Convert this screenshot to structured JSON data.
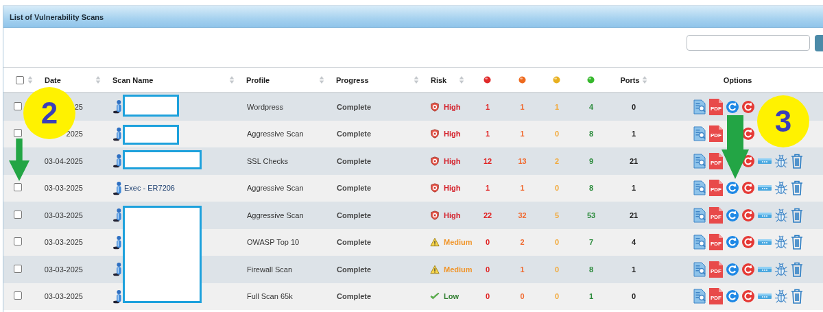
{
  "panel": {
    "title": "List of Vulnerability Scans"
  },
  "table": {
    "select_all": {
      "checked": false
    },
    "columns": [
      {
        "kind": "text",
        "label": "Date",
        "sortable": true
      },
      {
        "kind": "text",
        "label": "Scan Name",
        "sortable": true
      },
      {
        "kind": "text",
        "label": "Profile",
        "sortable": true
      },
      {
        "kind": "text",
        "label": "Progress",
        "sortable": true
      },
      {
        "kind": "text",
        "label": "Risk",
        "sortable": true
      },
      {
        "kind": "dot",
        "color": "#e02a2a"
      },
      {
        "kind": "dot",
        "color": "#ee6a1e"
      },
      {
        "kind": "dot",
        "color": "#e8b020"
      },
      {
        "kind": "dot",
        "color": "#36b82c"
      },
      {
        "kind": "text",
        "label": "Ports",
        "sortable": true
      },
      {
        "kind": "text",
        "label": "Options",
        "sortable": false
      }
    ],
    "rows": [
      {
        "checked": false,
        "date": "25",
        "profile": "Wordpress",
        "progress": "Complete",
        "risk": {
          "label": "High",
          "kind": "high"
        },
        "counts": [
          "1",
          "1",
          "1",
          "4"
        ],
        "ports": "0",
        "pdf_label": "PDF"
      },
      {
        "checked": false,
        "date": "2025",
        "profile": "Aggressive Scan",
        "progress": "Complete",
        "risk": {
          "label": "High",
          "kind": "high"
        },
        "counts": [
          "1",
          "1",
          "0",
          "8"
        ],
        "ports": "1",
        "pdf_label": "PDF"
      },
      {
        "date": "03-04-2025",
        "profile": "SSL Checks",
        "progress": "Complete",
        "risk": {
          "label": "High",
          "kind": "high"
        },
        "counts": [
          "12",
          "13",
          "2",
          "9"
        ],
        "ports": "21",
        "pdf_label": "PDF"
      },
      {
        "checked": false,
        "date": "03-03-2025",
        "scan_name": "Exec - ER7206",
        "profile": "Aggressive Scan",
        "progress": "Complete",
        "risk": {
          "label": "High",
          "kind": "high"
        },
        "counts": [
          "1",
          "1",
          "0",
          "8"
        ],
        "ports": "1",
        "pdf_label": "PDF"
      },
      {
        "checked": false,
        "date": "03-03-2025",
        "profile": "Aggressive Scan",
        "progress": "Complete",
        "risk": {
          "label": "High",
          "kind": "high"
        },
        "counts": [
          "22",
          "32",
          "5",
          "53"
        ],
        "ports": "21",
        "pdf_label": "PDF"
      },
      {
        "checked": false,
        "date": "03-03-2025",
        "profile": "OWASP Top 10",
        "progress": "Complete",
        "risk": {
          "label": "Medium",
          "kind": "medium"
        },
        "counts": [
          "0",
          "2",
          "0",
          "7"
        ],
        "ports": "4",
        "pdf_label": "PDF"
      },
      {
        "checked": false,
        "date": "03-03-2025",
        "profile": "Firewall Scan",
        "progress": "Complete",
        "risk": {
          "label": "Medium",
          "kind": "medium"
        },
        "counts": [
          "0",
          "1",
          "0",
          "8"
        ],
        "ports": "1",
        "pdf_label": "PDF"
      },
      {
        "checked": false,
        "date": "03-03-2025",
        "profile": "Full Scan 65k",
        "progress": "Complete",
        "risk": {
          "label": "Low",
          "kind": "low"
        },
        "counts": [
          "0",
          "0",
          "0",
          "1"
        ],
        "ports": "0",
        "pdf_label": "PDF"
      }
    ]
  },
  "callouts": [
    {
      "label": "2"
    },
    {
      "label": "3"
    }
  ]
}
